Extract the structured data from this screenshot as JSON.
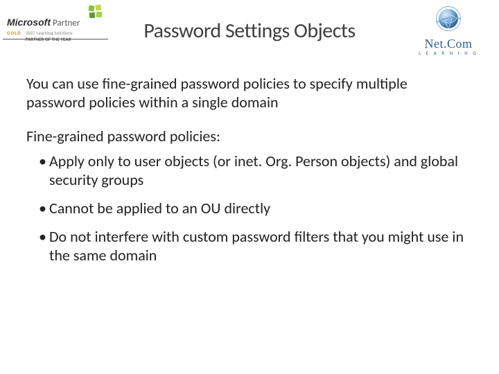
{
  "header": {
    "ms_brand": "Microsoft",
    "partner_word": "Partner",
    "gold_label": "GOLD",
    "sub1": "2007 Learning Solutions",
    "sub2": "PARTNER OF THE YEAR",
    "netcom_name": "Net.Com",
    "netcom_sub": "L E A R N I N G"
  },
  "title": "Password Settings Objects",
  "body": {
    "intro": "You can use fine-grained password policies to specify multiple password policies within a single domain",
    "subhead": "Fine-grained password policies:",
    "bullets": [
      "Apply only to user objects (or inet. Org. Person objects) and global   security groups",
      "Cannot be applied to an OU directly",
      "Do not interfere with custom password filters that you might use in the same domain"
    ]
  }
}
